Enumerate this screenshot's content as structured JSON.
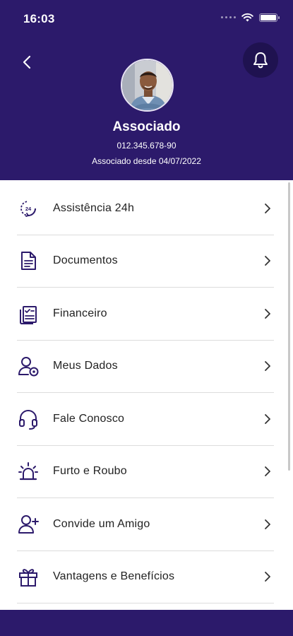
{
  "status_bar": {
    "time": "16:03"
  },
  "profile": {
    "name": "Associado",
    "id_number": "012.345.678-90",
    "member_since": "Associado desde 04/07/2022"
  },
  "menu": [
    {
      "label": "Assistência 24h",
      "icon": "clock-24h-icon"
    },
    {
      "label": "Documentos",
      "icon": "document-icon"
    },
    {
      "label": "Financeiro",
      "icon": "checklist-icon"
    },
    {
      "label": "Meus Dados",
      "icon": "user-settings-icon"
    },
    {
      "label": "Fale Conosco",
      "icon": "headset-icon"
    },
    {
      "label": "Furto e Roubo",
      "icon": "siren-icon"
    },
    {
      "label": "Convide um Amigo",
      "icon": "user-add-icon"
    },
    {
      "label": "Vantagens e Benefícios",
      "icon": "gift-icon"
    }
  ],
  "colors": {
    "primary": "#2c1a6b",
    "bell_bg": "#1f1250"
  }
}
